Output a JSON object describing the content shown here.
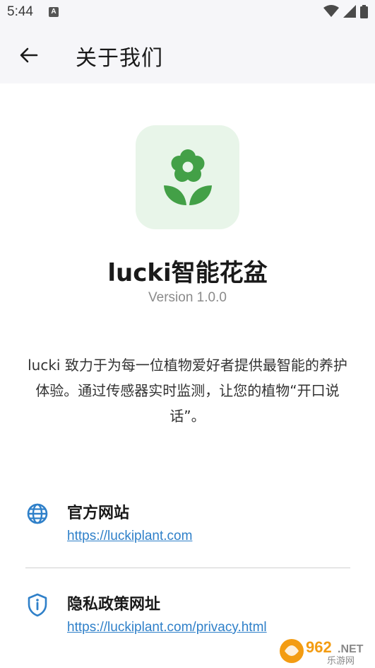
{
  "status_bar": {
    "time": "5:44"
  },
  "app_bar": {
    "title": "关于我们"
  },
  "about": {
    "app_name": "lucki智能花盆",
    "version": "Version 1.0.0",
    "description": "lucki 致力于为每一位植物爱好者提供最智能的养护体验。通过传感器实时监测，让您的植物“开口说话”。"
  },
  "links": [
    {
      "icon": "globe-icon",
      "label": "官方网站",
      "url": "https://luckiplant.com"
    },
    {
      "icon": "shield-icon",
      "label": "隐私政策网址",
      "url": "https://luckiplant.com/privacy.html"
    }
  ],
  "watermark": {
    "brand": "962.NET",
    "sub": "乐游网"
  },
  "colors": {
    "accent_blue": "#2f80c9",
    "logo_green": "#43a047",
    "logo_bg": "#e8f5e9",
    "appbar_bg": "#f6f6f9"
  }
}
